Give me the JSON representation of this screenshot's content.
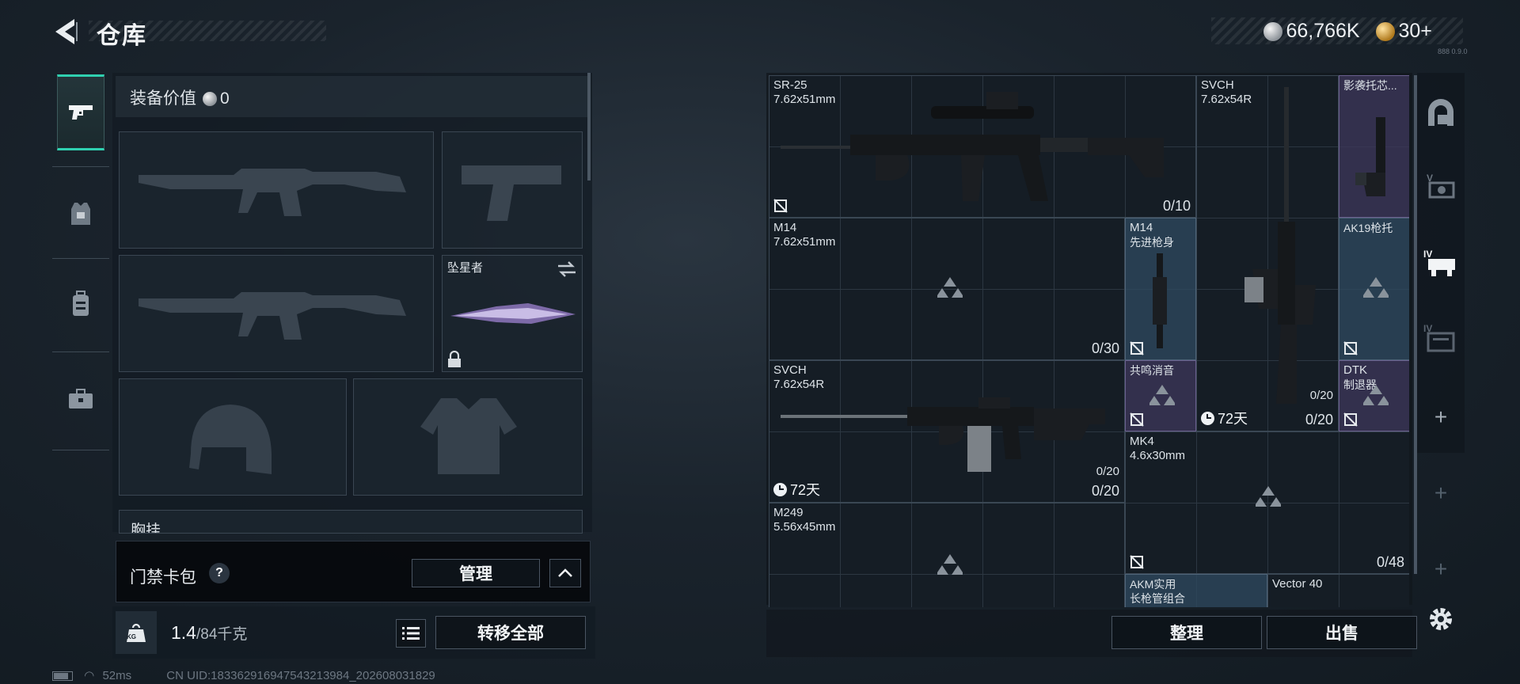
{
  "header": {
    "title": "仓库",
    "currency_silver": "66,766K",
    "currency_gold": "30+",
    "version": "888 0.9.0"
  },
  "left_panel": {
    "equip_value_label": "装备价值",
    "equip_value": "0",
    "melee_name": "坠星者",
    "section_partial": "胸挂",
    "card_pack_label": "门禁卡包",
    "manage_button": "管理",
    "weight_current": "1.4",
    "weight_max": "/84千克",
    "weight_unit_badge": "KG",
    "transfer_all_button": "转移全部"
  },
  "status": {
    "latency": "52ms",
    "uid": "CN UID:18336291694754321398​4_202608031829"
  },
  "grid": {
    "items": [
      {
        "name": "SR-25",
        "caliber": "7.62x51mm",
        "ammo": "0/10"
      },
      {
        "name": "SVCH",
        "caliber": "7.62x54R",
        "ammo": "0/20",
        "days": "72天"
      },
      {
        "name": "影袭托芯..."
      },
      {
        "name": "M14",
        "caliber": "7.62x51mm",
        "ammo": "0/30"
      },
      {
        "name": "M14",
        "caliber": "先进枪身"
      },
      {
        "name": "AK19枪托"
      },
      {
        "name": "SVCH",
        "caliber": "7.62x54R",
        "ammo": "0/20",
        "ammo_small": "0/20",
        "days": "72天"
      },
      {
        "name": "共鸣消音"
      },
      {
        "name": "DTK",
        "caliber": "制退器"
      },
      {
        "name": "MK4",
        "caliber": "4.6x30mm",
        "ammo": "0/48"
      },
      {
        "name": "M249",
        "caliber": "5.56x45mm"
      },
      {
        "name": "AKM实用",
        "caliber": "长枪管组合"
      },
      {
        "name": "Vector 40"
      }
    ],
    "svch_tall_small_ammo": "0/20"
  },
  "buttons": {
    "sort": "整理",
    "sell": "出售"
  },
  "colors": {
    "accent": "#2fd0b0",
    "blue_rarity": "#2e485e",
    "purple_rarity": "#3c3658"
  }
}
